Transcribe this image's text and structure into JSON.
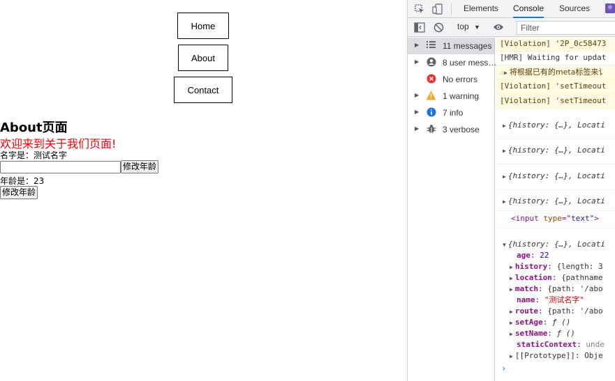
{
  "page": {
    "nav": {
      "home": "Home",
      "about": "About",
      "contact": "Contact"
    },
    "title": "About页面",
    "welcome": "欢迎来到关于我们页面!",
    "name_line": "名字是：测试名字",
    "age_input_value": "",
    "change_age_button": "修改年龄",
    "age_line": "年龄是：23",
    "change_age_button_2": "修改年龄",
    "colors": {
      "welcome": "#e00000"
    }
  },
  "devtools": {
    "tabs": {
      "elements": "Elements",
      "console": "Console",
      "sources": "Sources"
    },
    "toolbar": {
      "context": "top",
      "filter_placeholder": "Filter"
    },
    "sidebar": [
      {
        "label": "11 messages",
        "icon": "list-icon"
      },
      {
        "label": "8 user mess…",
        "icon": "user-icon"
      },
      {
        "label": "No errors",
        "icon": "error-icon"
      },
      {
        "label": "1 warning",
        "icon": "warning-icon"
      },
      {
        "label": "7 info",
        "icon": "info-icon"
      },
      {
        "label": "3 verbose",
        "icon": "bug-icon"
      }
    ],
    "console": {
      "violation_1": "[Violation] '2P_0c58473",
      "hmr": "[HMR] Waiting for updat",
      "warning": "将根据已有的meta标签来讠",
      "violation_2": "[Violation] 'setTimeout",
      "violation_3": "[Violation] 'setTimeout",
      "obj_collapsed": "{history: {…}, Locati",
      "input_tag": "input",
      "input_attr": "type",
      "input_attr_val": "\"text\"",
      "expanded": {
        "summary": "{history: {…}, Locati",
        "age_key": "age",
        "age_val": "22",
        "history_key": "history",
        "history_val": "{length: 3",
        "location_key": "location",
        "location_val": "{pathname",
        "match_key": "match",
        "match_val": "{path: '/abo",
        "name_key": "name",
        "name_val": "\"测试名字\"",
        "route_key": "route",
        "route_val": "{path: '/abo",
        "setAge_key": "setAge",
        "setAge_val": "ƒ ()",
        "setName_key": "setName",
        "setName_val": "ƒ ()",
        "staticContext_key": "staticContext",
        "staticContext_val": "unde",
        "prototype_key": "[[Prototype]]",
        "prototype_val": "Obje"
      }
    }
  }
}
